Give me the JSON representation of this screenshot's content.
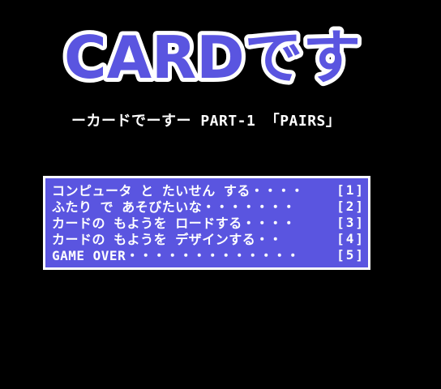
{
  "logo": {
    "text": "CARDです",
    "fill_color": "#5a55e0",
    "outline_color": "#ffffff"
  },
  "subtitle": "ーカードでーすー PART-1 「PAIRS」",
  "menu": {
    "background_color": "#5a55e0",
    "border_color": "#ffffff",
    "items": [
      {
        "label": "コンピュータ と たいせん する・・・・",
        "key": "[1]"
      },
      {
        "label": "ふたり で あそびたいな・・・・・・・",
        "key": "[2]"
      },
      {
        "label": "カードの もようを ロードする・・・・",
        "key": "[3]"
      },
      {
        "label": "カードの もようを デザインする・・",
        "key": "[4]"
      },
      {
        "label": "GAME OVER・・・・・・・・・・・・・",
        "key": "[5]"
      }
    ]
  }
}
